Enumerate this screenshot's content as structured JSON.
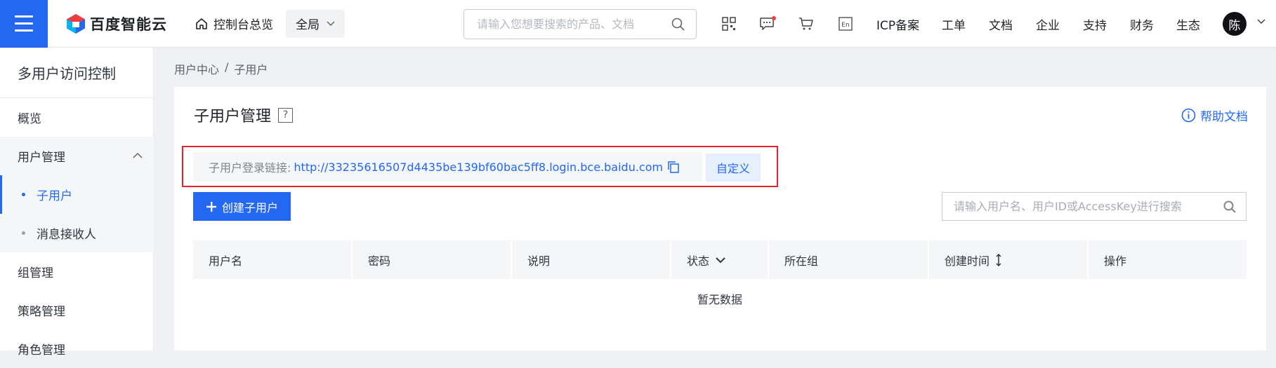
{
  "topbar": {
    "logo_text": "百度智能云",
    "home_label": "控制台总览",
    "region_label": "全局",
    "search_placeholder": "请输入您想要搜索的产品、文档",
    "icons": [
      "qrcode-icon",
      "message-icon",
      "cart-icon",
      "language-en-icon"
    ],
    "lang_badge": "En",
    "links": [
      "ICP备案",
      "工单",
      "文档",
      "企业",
      "支持",
      "财务",
      "生态"
    ],
    "avatar_text": "陈",
    "accent_color": "#2468f2"
  },
  "sidebar": {
    "title": "多用户访问控制",
    "items": [
      {
        "label": "概览"
      },
      {
        "label": "用户管理"
      },
      {
        "label": "子用户"
      },
      {
        "label": "消息接收人"
      },
      {
        "label": "组管理"
      },
      {
        "label": "策略管理"
      },
      {
        "label": "角色管理"
      }
    ]
  },
  "breadcrumb": {
    "items": [
      "用户中心",
      "子用户"
    ],
    "separator": "/"
  },
  "main": {
    "title": "子用户管理",
    "title_help": "?",
    "help_doc": "帮助文档",
    "login_label": "子用户登录链接:",
    "login_url": "http://33235616507d4435be139bf60bac5ff8.login.bce.baidu.com",
    "custom_button": "自定义",
    "create_button": "创建子用户",
    "search_placeholder": "请输入用户名、用户ID或AccessKey进行搜索",
    "table": {
      "columns": [
        "用户名",
        "密码",
        "说明",
        "状态",
        "所在组",
        "创建时间",
        "操作"
      ],
      "empty_text": "暂无数据"
    },
    "highlight_color": "#e8232b"
  }
}
